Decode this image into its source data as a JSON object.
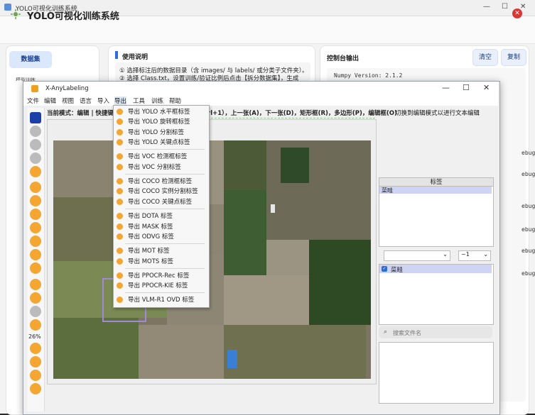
{
  "back_window": {
    "title": "YOLO可视化训练系统",
    "app_title": "YOLO可视化训练系统",
    "left_nav": {
      "dataset_label": "数据集",
      "partial_label": "模型训练"
    },
    "usage": {
      "title": "使用说明",
      "line1": "① 选择标注后的数据目录（含 images/ 与 labels/ 或分类子文件夹）。",
      "line2": "② 选择 Class.txt，设置训练/验证比例后点击【拆分数据集】，生成"
    },
    "console": {
      "title": "控制台输出",
      "clear_label": "清空",
      "copy_label": "复制",
      "line1": "Numpy Version: 2.1.2",
      "debug_fragment": "ebug\\"
    }
  },
  "front_window": {
    "title": "X-AnyLabeling",
    "menus": [
      "文件",
      "编辑",
      "视图",
      "语言",
      "导入",
      "导出",
      "工具",
      "训练",
      "帮助"
    ],
    "mode_text": "当前模式：编辑 | 快捷键：",
    "shortcut_text": "rl+1），上一张(A)，下一张(D)，矩形框(R)，多边形(P)，编辑框(O)",
    "switch_text": "切换到编辑模式以进行文本编辑",
    "zoom": "26%",
    "labels_header": "标签",
    "label_item": "菜畦",
    "combo2": "~1",
    "flag_item": "菜畦",
    "search_placeholder": "搜索文件名"
  },
  "export_menu": {
    "groups": [
      [
        "导出 YOLO 水平框标签",
        "导出 YOLO 旋转框标签",
        "导出 YOLO 分割标签",
        "导出 YOLO 关键点标签"
      ],
      [
        "导出 VOC 检测框标签",
        "导出 VOC 分割标签"
      ],
      [
        "导出 COCO 检测框标签",
        "导出 COCO 实例分割标签",
        "导出 COCO 关键点标签"
      ],
      [
        "导出 DOTA 标签",
        "导出 MASK 标签",
        "导出 ODVG 标签"
      ],
      [
        "导出 MOT 标签",
        "导出 MOTS 标签"
      ],
      [
        "导出 PPOCR-Rec 标签",
        "导出 PPOCR-KIE 标签"
      ],
      [
        "导出 VLM-R1 OVD 标签"
      ]
    ]
  },
  "colors": {
    "accent": "#2b6fd6",
    "menu_icon": "#f3a632",
    "close_red": "#d93636"
  }
}
